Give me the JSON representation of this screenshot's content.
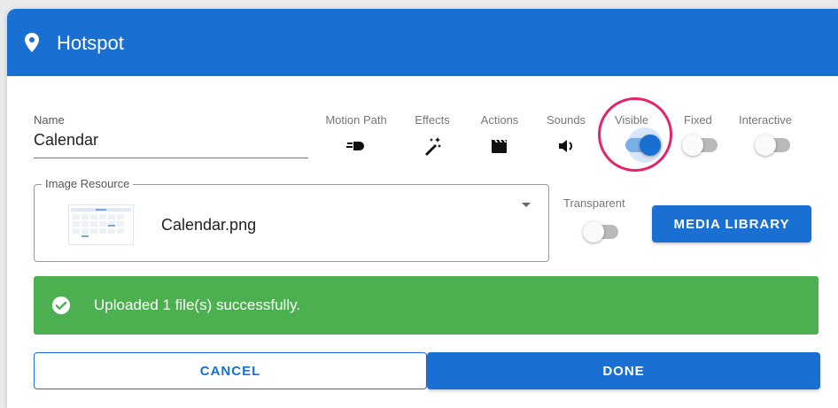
{
  "header": {
    "title": "Hotspot",
    "icon": "map-pin-icon",
    "color": "#1a6fd3"
  },
  "name_field": {
    "label": "Name",
    "value": "Calendar"
  },
  "tools": [
    {
      "label": "Motion Path",
      "icon": "motion-path-icon"
    },
    {
      "label": "Effects",
      "icon": "magic-wand-icon"
    },
    {
      "label": "Actions",
      "icon": "clapperboard-icon"
    },
    {
      "label": "Sounds",
      "icon": "speaker-icon"
    }
  ],
  "toggles": {
    "visible": {
      "label": "Visible",
      "on": true
    },
    "fixed": {
      "label": "Fixed",
      "on": false
    },
    "interactive": {
      "label": "Interactive",
      "on": false
    },
    "transparent": {
      "label": "Transparent",
      "on": false
    }
  },
  "image_resource": {
    "label": "Image Resource",
    "file_name": "Calendar.png"
  },
  "media_library_label": "MEDIA LIBRARY",
  "alert": {
    "message": "Uploaded 1 file(s) successfully.",
    "color": "#4caf50"
  },
  "footer": {
    "cancel_label": "CANCEL",
    "done_label": "DONE"
  },
  "highlight_color": "#e4236a"
}
